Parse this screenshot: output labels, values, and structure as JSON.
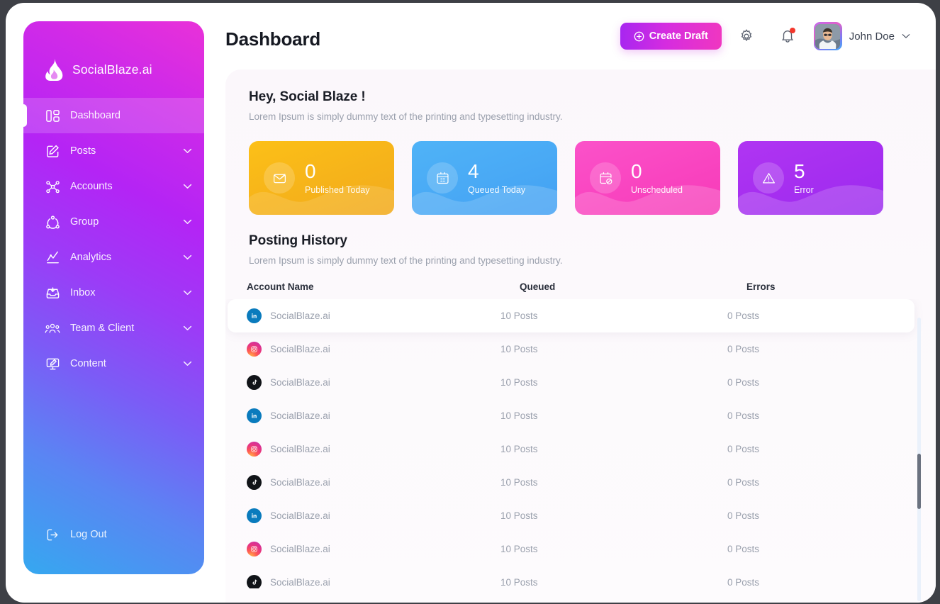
{
  "brand": {
    "name": "SocialBlaze.ai",
    "logo_icon": "flame-icon"
  },
  "header": {
    "title": "Dashboard",
    "create_draft_label": "Create Draft",
    "settings_icon": "gear-icon",
    "notifications_icon": "bell-icon",
    "user_name": "John Doe",
    "caret_icon": "chevron-down-icon"
  },
  "sidebar": {
    "items": [
      {
        "label": "Dashboard",
        "icon": "grid-layout-icon",
        "active": true,
        "expandable": false
      },
      {
        "label": "Posts",
        "icon": "edit-square-icon",
        "active": false,
        "expandable": true
      },
      {
        "label": "Accounts",
        "icon": "network-nodes-icon",
        "active": false,
        "expandable": true
      },
      {
        "label": "Group",
        "icon": "group-circle-icon",
        "active": false,
        "expandable": true
      },
      {
        "label": "Analytics",
        "icon": "line-chart-icon",
        "active": false,
        "expandable": true
      },
      {
        "label": "Inbox",
        "icon": "inbox-icon",
        "active": false,
        "expandable": true
      },
      {
        "label": "Team & Client",
        "icon": "people-icon",
        "active": false,
        "expandable": true
      },
      {
        "label": "Content",
        "icon": "monitor-edit-icon",
        "active": false,
        "expandable": true
      }
    ],
    "logout": {
      "label": "Log Out",
      "icon": "logout-icon"
    }
  },
  "greeting": {
    "title": "Hey, Social Blaze !",
    "subtitle": "Lorem Ipsum is simply dummy text of the printing and typesetting industry."
  },
  "stat_cards": [
    {
      "value": "0",
      "label": "Published Today",
      "color": "#f6b31a",
      "theme": "card-yellow",
      "icon": "mail-sent-icon"
    },
    {
      "value": "4",
      "label": "Queued Today",
      "color": "#49a9f5",
      "theme": "card-blue",
      "icon": "calendar-grid-icon"
    },
    {
      "value": "0",
      "label": "Unscheduled",
      "color": "#f944c0",
      "theme": "card-pink",
      "icon": "calendar-block-icon"
    },
    {
      "value": "5",
      "label": "Error",
      "color": "#a52ef0",
      "theme": "card-purple",
      "icon": "warning-triangle-icon"
    }
  ],
  "posting_history": {
    "title": "Posting History",
    "subtitle": "Lorem Ipsum is simply dummy text of the printing and typesetting industry.",
    "columns": [
      "Account Name",
      "Queued",
      "Errors"
    ],
    "rows": [
      {
        "platform": "linkedin",
        "account": "SocialBlaze.ai",
        "queued": "10 Posts",
        "errors": "0 Posts",
        "highlighted": true
      },
      {
        "platform": "instagram",
        "account": "SocialBlaze.ai",
        "queued": "10 Posts",
        "errors": "0 Posts",
        "highlighted": false
      },
      {
        "platform": "tiktok",
        "account": "SocialBlaze.ai",
        "queued": "10 Posts",
        "errors": "0 Posts",
        "highlighted": false
      },
      {
        "platform": "linkedin",
        "account": "SocialBlaze.ai",
        "queued": "10 Posts",
        "errors": "0 Posts",
        "highlighted": false
      },
      {
        "platform": "instagram",
        "account": "SocialBlaze.ai",
        "queued": "10 Posts",
        "errors": "0 Posts",
        "highlighted": false
      },
      {
        "platform": "tiktok",
        "account": "SocialBlaze.ai",
        "queued": "10 Posts",
        "errors": "0 Posts",
        "highlighted": false
      },
      {
        "platform": "linkedin",
        "account": "SocialBlaze.ai",
        "queued": "10 Posts",
        "errors": "0 Posts",
        "highlighted": false
      },
      {
        "platform": "instagram",
        "account": "SocialBlaze.ai",
        "queued": "10 Posts",
        "errors": "0 Posts",
        "highlighted": false
      },
      {
        "platform": "tiktok",
        "account": "SocialBlaze.ai",
        "queued": "10 Posts",
        "errors": "0 Posts",
        "highlighted": false
      }
    ]
  },
  "theme": {
    "sidebar_gradient_start": "#e931d8",
    "sidebar_gradient_end": "#35a8f0",
    "accent": "#d52ce0",
    "notification_dot": "#f3372c"
  }
}
